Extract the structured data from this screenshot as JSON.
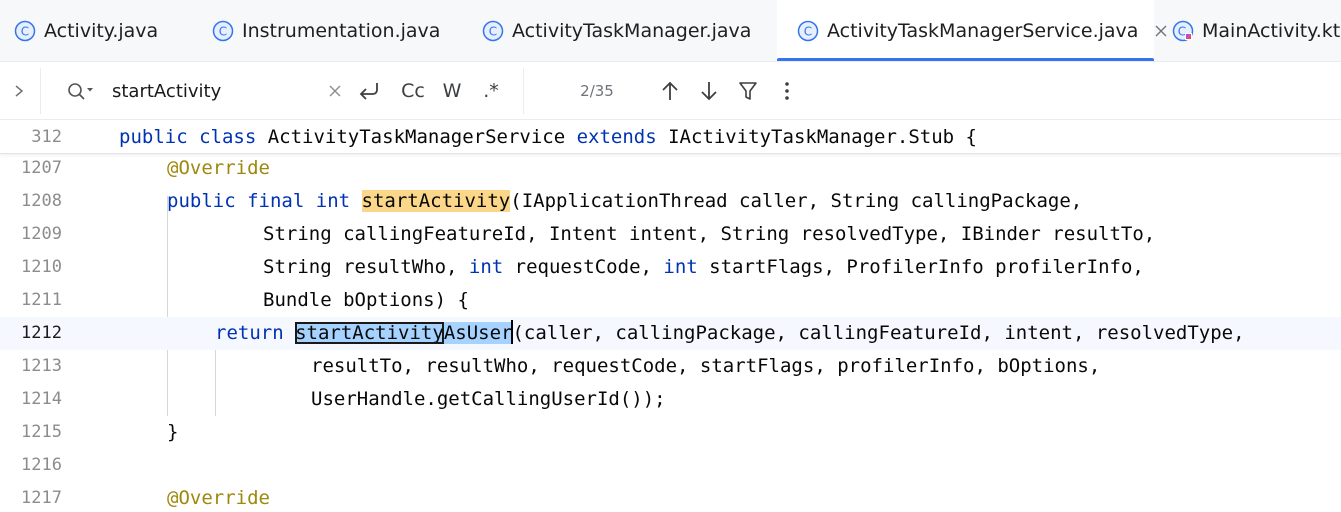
{
  "tabs": [
    {
      "label": "Activity.java",
      "icon": "java-class-icon",
      "active": false
    },
    {
      "label": "Instrumentation.java",
      "icon": "java-class-icon",
      "active": false
    },
    {
      "label": "ActivityTaskManager.java",
      "icon": "java-class-icon",
      "active": false
    },
    {
      "label": "ActivityTaskManagerService.java",
      "icon": "java-class-icon",
      "active": true,
      "close": "×"
    },
    {
      "label": "MainActivity.kt",
      "icon": "kotlin-class-icon",
      "active": false
    }
  ],
  "find": {
    "expand": "›",
    "query": "startActivity",
    "clear": "×",
    "match_case": "Cc",
    "whole_words": "W",
    "regex": ".*",
    "match_count": "2/35",
    "more": "⋮"
  },
  "sticky_line": {
    "number": "312",
    "text": "public class ActivityTaskManagerService extends IActivityTaskManager.Stub {"
  },
  "lines": [
    {
      "n": "1207",
      "t": "@Override"
    },
    {
      "n": "1208",
      "t": "public final int startActivity(IApplicationThread caller, String callingPackage,"
    },
    {
      "n": "1209",
      "t": "String callingFeatureId, Intent intent, String resolvedType, IBinder resultTo,"
    },
    {
      "n": "1210",
      "t": "String resultWho, int requestCode, int startFlags, ProfilerInfo profilerInfo,"
    },
    {
      "n": "1211",
      "t": "Bundle bOptions) {"
    },
    {
      "n": "1212",
      "t": "return startActivityAsUser(caller, callingPackage, callingFeatureId, intent, resolvedType,"
    },
    {
      "n": "1213",
      "t": "resultTo, resultWho, requestCode, startFlags, profilerInfo, bOptions,"
    },
    {
      "n": "1214",
      "t": "UserHandle.getCallingUserId());"
    },
    {
      "n": "1215",
      "t": "}"
    },
    {
      "n": "1216",
      "t": ""
    },
    {
      "n": "1217",
      "t": "@Override"
    }
  ],
  "tokens": {
    "kw_public": "public",
    "kw_class": "class",
    "kw_extends": "extends",
    "class_name": " ActivityTaskManagerService ",
    "super_name": " IActivityTaskManager.Stub {",
    "annotation": "@Override",
    "kw_final": "final",
    "kw_int": "int",
    "method_name": "startActivity",
    "l1208_rest": "(IApplicationThread caller, String callingPackage,",
    "l1209": "String callingFeatureId, Intent intent, String resolvedType, IBinder resultTo,",
    "l1210_a": "String resultWho, ",
    "l1210_b": " requestCode, ",
    "l1210_c": " startFlags, ProfilerInfo profilerInfo,",
    "l1211": "Bundle bOptions) {",
    "kw_return": "return",
    "call_match": "startActivity",
    "call_rest_sel": "AsUser",
    "l1212_rest": "(caller, callingPackage, callingFeatureId, intent, resolvedType,",
    "l1213": "resultTo, resultWho, requestCode, startFlags, profilerInfo, bOptions,",
    "l1214": "UserHandle.getCallingUserId());",
    "l1215": "}"
  },
  "colors": {
    "keyword": "#0033b3",
    "annotation": "#9e880d",
    "match_highlight": "#fbd78a",
    "selection": "#a6d2ff",
    "tab_accent": "#3574f0",
    "current_line": "#f5f8fe"
  }
}
